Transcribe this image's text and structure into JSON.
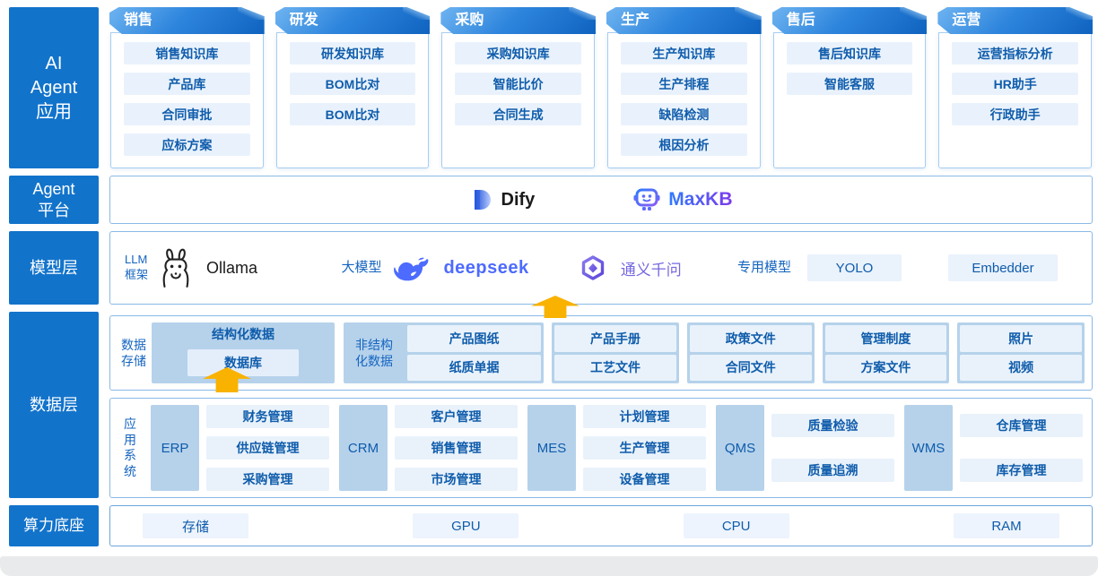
{
  "palette": {
    "rail_blue": "#1273cb",
    "header_gradient": [
      "#6fb4f1",
      "#0f63c0"
    ],
    "pill_bg": "#e9f2fc",
    "pill_text": "#0f5cab",
    "block_blue": "#b6d2eb",
    "arrow_orange": "#f9b200",
    "deepseek_blue": "#4d6bfe",
    "qwen_purple": "#7668e0",
    "maxkb_gradient": [
      "#2f7bff",
      "#7c3aed"
    ]
  },
  "left_rail": {
    "items": [
      {
        "label": "AI\nAgent\n应用"
      },
      {
        "label": "Agent\n平台"
      },
      {
        "label": "模型层"
      },
      {
        "label": "数据层"
      },
      {
        "label": "算力底座"
      }
    ]
  },
  "agent_apps": {
    "cards": [
      {
        "title": "销售",
        "items": [
          "销售知识库",
          "产品库",
          "合同审批",
          "应标方案"
        ]
      },
      {
        "title": "研发",
        "items": [
          "研发知识库",
          "BOM比对",
          "BOM比对"
        ]
      },
      {
        "title": "采购",
        "items": [
          "采购知识库",
          "智能比价",
          "合同生成"
        ]
      },
      {
        "title": "生产",
        "items": [
          "生产知识库",
          "生产排程",
          "缺陷检测",
          "根因分析"
        ]
      },
      {
        "title": "售后",
        "items": [
          "售后知识库",
          "智能客服"
        ]
      },
      {
        "title": "运营",
        "items": [
          "运营指标分析",
          "HR助手",
          "行政助手"
        ]
      }
    ]
  },
  "platform_row": {
    "products": [
      {
        "name": "Dify",
        "icon": "dify-logo"
      },
      {
        "name": "MaxKB",
        "icon": "maxkb-robot-logo"
      }
    ]
  },
  "model_layer": {
    "llm_framework_label": "LLM\n框架",
    "ollama": "Ollama",
    "big_model_label": "大模型",
    "deepseek": "deepseek",
    "qwen": "通义千问",
    "special_model_label": "专用模型",
    "special_models": [
      "YOLO",
      "Embedder"
    ]
  },
  "data_layer": {
    "storage_label": "数据\n存储",
    "structured": {
      "title": "结构化数据",
      "item": "数据库"
    },
    "unstructured": {
      "label": "非结构\n化数据",
      "groups": [
        [
          "产品图纸",
          "纸质单据"
        ],
        [
          "产品手册",
          "工艺文件"
        ],
        [
          "政策文件",
          "合同文件"
        ],
        [
          "管理制度",
          "方案文件"
        ],
        [
          "照片",
          "视频"
        ]
      ]
    },
    "app_systems_label": "应\n用\n系\n统",
    "systems": [
      {
        "name": "ERP",
        "modules": [
          "财务管理",
          "供应链管理",
          "采购管理"
        ]
      },
      {
        "name": "CRM",
        "modules": [
          "客户管理",
          "销售管理",
          "市场管理"
        ]
      },
      {
        "name": "MES",
        "modules": [
          "计划管理",
          "生产管理",
          "设备管理"
        ]
      },
      {
        "name": "QMS",
        "modules": [
          "质量检验",
          "质量追溯"
        ]
      },
      {
        "name": "WMS",
        "modules": [
          "仓库管理",
          "库存管理"
        ]
      }
    ]
  },
  "compute_base": {
    "items": [
      "存储",
      "GPU",
      "CPU",
      "RAM"
    ]
  }
}
